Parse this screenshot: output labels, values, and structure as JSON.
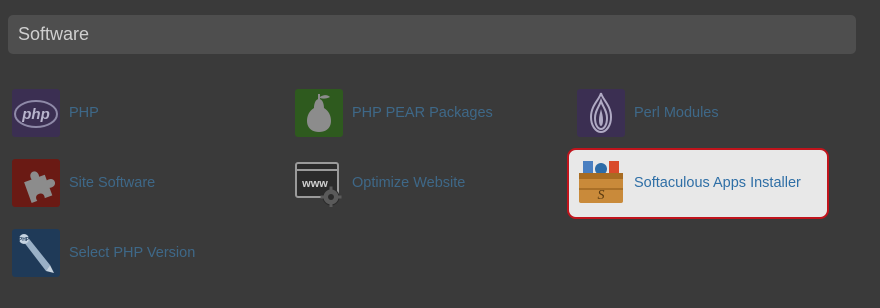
{
  "section": {
    "title": "Software"
  },
  "items": [
    {
      "label": "PHP",
      "icon": "php-icon"
    },
    {
      "label": "PHP PEAR Packages",
      "icon": "pear-icon"
    },
    {
      "label": "Perl Modules",
      "icon": "onion-icon"
    },
    {
      "label": "Site Software",
      "icon": "puzzle-icon"
    },
    {
      "label": "Optimize Website",
      "icon": "www-gear-icon"
    },
    {
      "label": "Softaculous Apps Installer",
      "icon": "toolbox-icon"
    },
    {
      "label": "Select PHP Version",
      "icon": "php-pen-icon"
    }
  ],
  "colors": {
    "overlay_background": "#3a3a3a",
    "link": "#3e6888",
    "highlight_border": "#c0141c",
    "highlight_background": "#e8e8e8"
  }
}
